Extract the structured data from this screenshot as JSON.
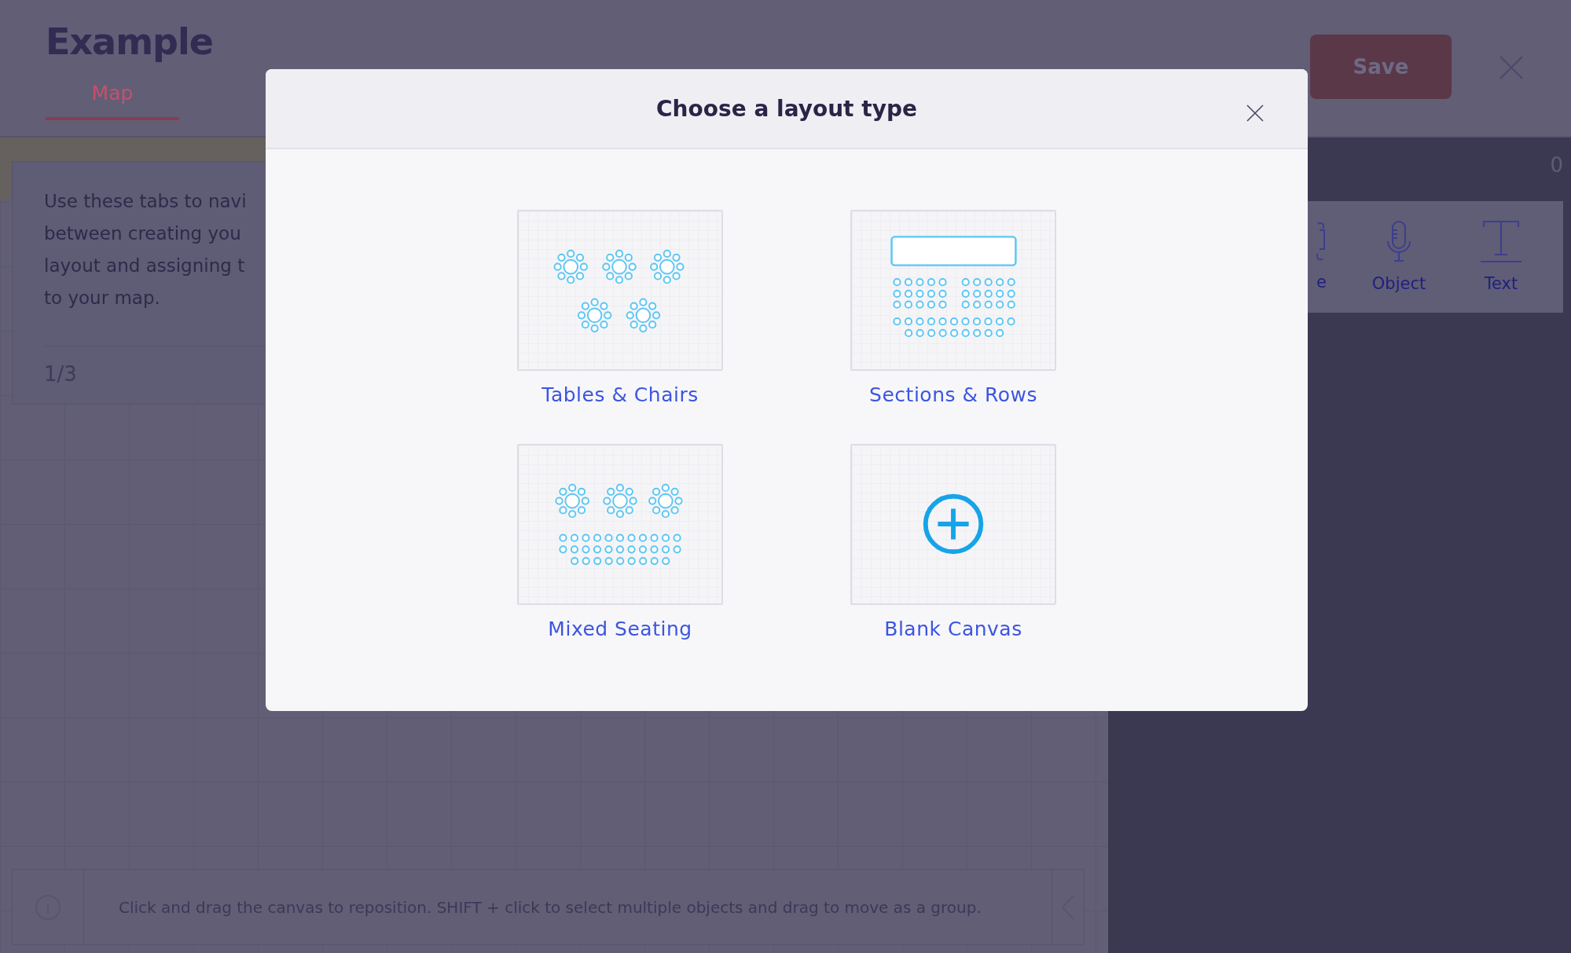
{
  "header": {
    "title": "Example",
    "save_button": "Save"
  },
  "tabs": [
    {
      "label": "Map",
      "selected": true
    }
  ],
  "tooltip": {
    "lines": [
      "Use these tabs to navi",
      "between creating you",
      "layout and assigning t",
      "to your map."
    ],
    "step": "1/3"
  },
  "side_panel": {
    "count": "0",
    "tools": [
      {
        "label": "e",
        "kind": "cut"
      },
      {
        "label": "Object",
        "kind": "microphone"
      },
      {
        "label": "Text",
        "kind": "text"
      }
    ]
  },
  "hint_bar": {
    "text": "Click and drag the canvas to reposition. SHIFT + click to select multiple objects and drag to move as a group."
  },
  "modal": {
    "title": "Choose a layout type",
    "options": [
      {
        "label": "Tables & Chairs",
        "kind": "tables"
      },
      {
        "label": "Sections & Rows",
        "kind": "sections"
      },
      {
        "label": "Mixed Seating",
        "kind": "mixed"
      },
      {
        "label": "Blank Canvas",
        "kind": "blank"
      }
    ]
  }
}
